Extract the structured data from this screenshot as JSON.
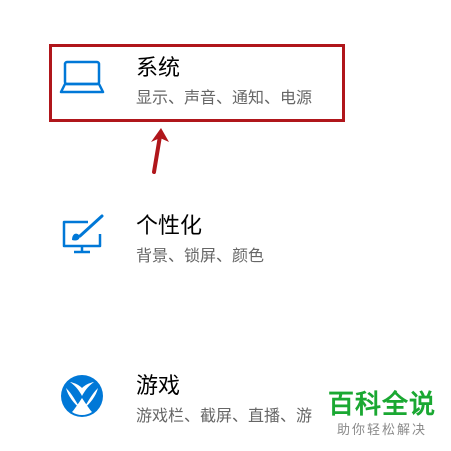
{
  "colors": {
    "icon_blue": "#0078d7",
    "highlight_red": "#b0161b",
    "desc_gray": "#666666",
    "watermark_green": "#1aa832"
  },
  "settings": {
    "items": [
      {
        "icon": "laptop-icon",
        "title": "系统",
        "description": "显示、声音、通知、电源"
      },
      {
        "icon": "personalization-brush-icon",
        "title": "个性化",
        "description": "背景、锁屏、颜色"
      },
      {
        "icon": "xbox-icon",
        "title": "游戏",
        "description": "游戏栏、截屏、直播、游"
      }
    ]
  },
  "annotation": {
    "highlight": "red-box",
    "arrow": "up-arrow"
  },
  "watermark": {
    "main": "百科全说",
    "sub": "助你轻松解决"
  }
}
